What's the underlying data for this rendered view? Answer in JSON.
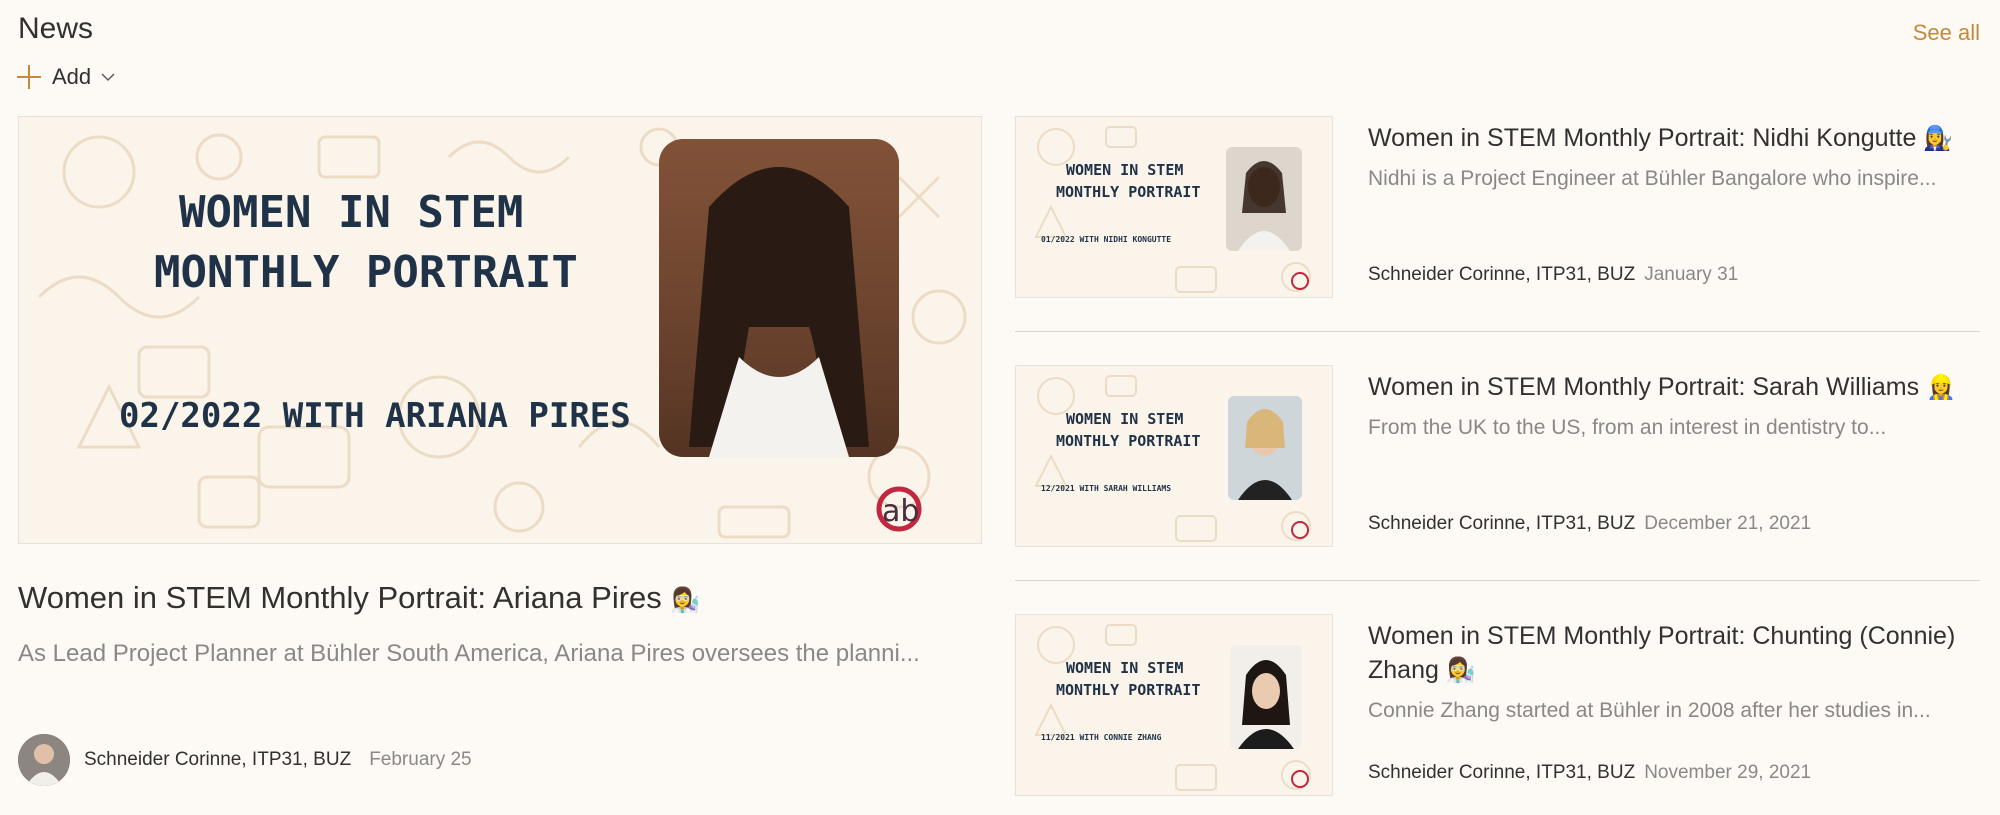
{
  "header": {
    "title": "News",
    "see_all": "See all"
  },
  "add": {
    "label": "Add",
    "plus_icon": "plus-icon",
    "chevron_icon": "chevron-down-icon"
  },
  "hero": {
    "image_line1": "WOMEN IN STEM",
    "image_line2": "MONTHLY PORTRAIT",
    "image_line3": "02/2022 WITH ARIANA PIRES",
    "logo_text": "ab",
    "title": "Women in STEM Monthly Portrait: Ariana Pires",
    "emoji": "👩‍🔬",
    "description": "As Lead Project Planner at Bühler South America, Ariana Pires oversees the planni...",
    "author": "Schneider Corinne, ITP31, BUZ",
    "date": "February 25"
  },
  "cards": [
    {
      "image_line1": "WOMEN IN STEM",
      "image_line2": "MONTHLY PORTRAIT",
      "image_line3": "01/2022 WITH NIDHI KONGUTTE",
      "title": "Women in STEM Monthly Portrait: Nidhi Kongutte",
      "emoji": "👩‍🔧",
      "description": "Nidhi is a Project Engineer at Bühler Bangalore who inspire...",
      "author": "Schneider Corinne, ITP31, BUZ",
      "date": "January 31"
    },
    {
      "image_line1": "WOMEN IN STEM",
      "image_line2": "MONTHLY PORTRAIT",
      "image_line3": "12/2021 WITH SARAH WILLIAMS",
      "title": "Women in STEM Monthly Portrait: Sarah Williams",
      "emoji": "👷‍♀️",
      "description": "From the UK to the US, from an interest in dentistry to...",
      "author": "Schneider Corinne, ITP31, BUZ",
      "date": "December 21, 2021"
    },
    {
      "image_line1": "WOMEN IN STEM",
      "image_line2": "MONTHLY PORTRAIT",
      "image_line3": "11/2021 WITH CONNIE ZHANG",
      "title": "Women in STEM Monthly Portrait: Chunting (Connie) Zhang",
      "emoji": "👩‍🔬",
      "description": "Connie Zhang started at Bühler in 2008 after her studies in...",
      "author": "Schneider Corinne, ITP31, BUZ",
      "date": "November 29, 2021"
    }
  ],
  "colors": {
    "accent": "#c28a3a",
    "text": "#323130",
    "muted": "#8a8886",
    "background": "#fdfaf6"
  }
}
